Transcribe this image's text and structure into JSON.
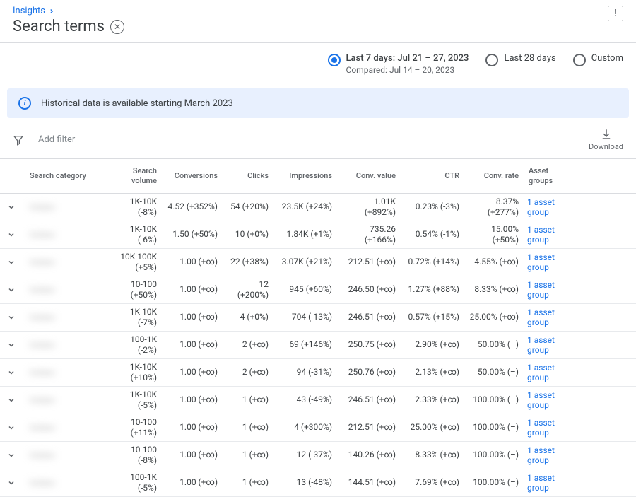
{
  "breadcrumb": {
    "label": "Insights"
  },
  "page_title": "Search terms",
  "date_range": {
    "selected": {
      "label": "Last 7 days: Jul 21 – 27, 2023",
      "compared": "Compared: Jul 14 – 20, 2023"
    },
    "opt28": "Last 28 days",
    "custom": "Custom"
  },
  "banner_text": "Historical data is available starting March 2023",
  "toolbar": {
    "add_filter": "Add filter",
    "download": "Download"
  },
  "columns": {
    "category": "Search category",
    "volume": "Search volume",
    "conversions": "Conversions",
    "clicks": "Clicks",
    "impressions": "Impressions",
    "conv_value": "Conv. value",
    "ctr": "CTR",
    "conv_rate": "Conv. rate",
    "asset_groups": "Asset groups"
  },
  "rows": [
    {
      "volume": "1K-10K (-8%)",
      "conversions": "4.52 (+352%)",
      "clicks": "54 (+20%)",
      "impressions": "23.5K (+24%)",
      "conv_value": "1.01K (+892%)",
      "ctr": "0.23% (-3%)",
      "conv_rate_l1": "8.37%",
      "conv_rate_l2": "(+277%)",
      "asset_groups": "1 asset group"
    },
    {
      "volume": "1K-10K (-6%)",
      "conversions": "1.50 (+50%)",
      "clicks": "10 (+0%)",
      "impressions": "1.84K (+1%)",
      "conv_value_l1": "735.26",
      "conv_value_l2": "(+166%)",
      "ctr": "0.54% (-1%)",
      "conv_rate_l1": "15.00%",
      "conv_rate_l2": "(+50%)",
      "asset_groups": "1 asset group"
    },
    {
      "volume_l1": "10K-100K",
      "volume_l2": "(+5%)",
      "conversions": "1.00 (+∞)",
      "clicks": "22 (+38%)",
      "impressions": "3.07K (+21%)",
      "conv_value": "212.51 (+∞)",
      "ctr": "0.72% (+14%)",
      "conv_rate_l1": "4.55% (+∞)",
      "conv_rate_l2": "",
      "asset_groups": "1 asset group"
    },
    {
      "volume_l1": "10-100",
      "volume_l2": "(+50%)",
      "conversions": "1.00 (+∞)",
      "clicks": "12 (+200%)",
      "impressions": "945 (+60%)",
      "conv_value": "246.50 (+∞)",
      "ctr": "1.27% (+88%)",
      "conv_rate_l1": "8.33% (+∞)",
      "conv_rate_l2": "",
      "asset_groups": "1 asset group"
    },
    {
      "volume": "1K-10K (-7%)",
      "conversions": "1.00 (+∞)",
      "clicks": "4 (+0%)",
      "impressions": "704 (-13%)",
      "conv_value": "246.51 (+∞)",
      "ctr": "0.57% (+15%)",
      "conv_rate_l1": "25.00% (+∞)",
      "conv_rate_l2": "",
      "asset_groups": "1 asset group"
    },
    {
      "volume": "100-1K (-2%)",
      "conversions": "1.00 (+∞)",
      "clicks": "2 (+∞)",
      "impressions": "69 (+146%)",
      "conv_value": "250.75 (+∞)",
      "ctr": "2.90% (+∞)",
      "conv_rate_l1": "50.00% (–)",
      "conv_rate_l2": "",
      "asset_groups": "1 asset group"
    },
    {
      "volume_l1": "1K-10K",
      "volume_l2": "(+10%)",
      "conversions": "1.00 (+∞)",
      "clicks": "2 (+∞)",
      "impressions": "94 (-31%)",
      "conv_value": "250.76 (+∞)",
      "ctr": "2.13% (+∞)",
      "conv_rate_l1": "50.00% (–)",
      "conv_rate_l2": "",
      "asset_groups": "1 asset group"
    },
    {
      "volume": "1K-10K (-5%)",
      "conversions": "1.00 (+∞)",
      "clicks": "1 (+∞)",
      "impressions": "43 (-49%)",
      "conv_value": "246.51 (+∞)",
      "ctr": "2.33% (+∞)",
      "conv_rate_l1": "100.00% (–)",
      "conv_rate_l2": "",
      "asset_groups": "1 asset group"
    },
    {
      "volume_l1": "10-100",
      "volume_l2": "(+11%)",
      "conversions": "1.00 (+∞)",
      "clicks": "1 (+∞)",
      "impressions": "4 (+300%)",
      "conv_value": "212.51 (+∞)",
      "ctr": "25.00% (+∞)",
      "conv_rate_l1": "100.00% (–)",
      "conv_rate_l2": "",
      "asset_groups": "1 asset group"
    },
    {
      "volume": "10-100 (-8%)",
      "conversions": "1.00 (+∞)",
      "clicks": "1 (+∞)",
      "impressions": "12 (-37%)",
      "conv_value": "140.26 (+∞)",
      "ctr": "8.33% (+∞)",
      "conv_rate_l1": "100.00% (–)",
      "conv_rate_l2": "",
      "asset_groups": "1 asset group"
    },
    {
      "volume": "100-1K (-5%)",
      "conversions": "1.00 (+∞)",
      "clicks": "1 (+∞)",
      "impressions": "13 (-48%)",
      "conv_value": "144.51 (+∞)",
      "ctr": "7.69% (+∞)",
      "conv_rate_l1": "100.00% (–)",
      "conv_rate_l2": "",
      "asset_groups": "1 asset group"
    }
  ]
}
